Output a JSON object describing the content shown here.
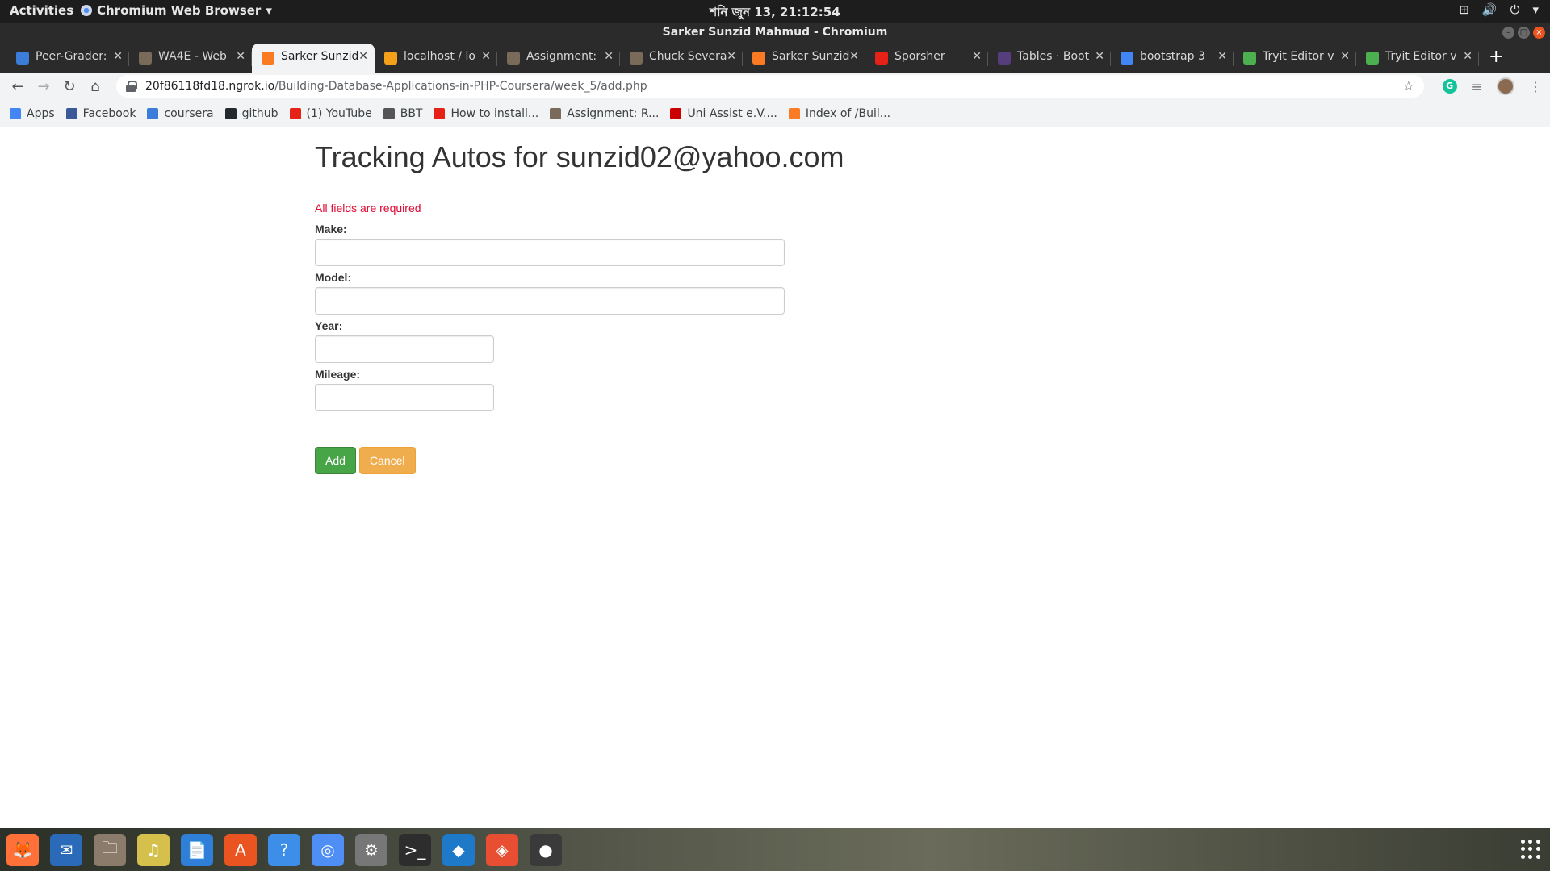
{
  "topbar": {
    "activities": "Activities",
    "app_menu": "Chromium Web Browser",
    "clock": "শনি জুন 13, 21:12:54"
  },
  "window": {
    "title": "Sarker Sunzid Mahmud - Chromium"
  },
  "tabs": [
    {
      "label": "Peer-Grader:",
      "icon": "coursera-icon",
      "color": "#3b7dd8",
      "active": false
    },
    {
      "label": "WA4E - Web",
      "icon": "wa4e-icon",
      "color": "#7a6a5a",
      "active": false
    },
    {
      "label": "Sarker Sunzid",
      "icon": "xampp-icon",
      "color": "#fb7a24",
      "active": true
    },
    {
      "label": "localhost / lo",
      "icon": "phpmyadmin-icon",
      "color": "#f4a019",
      "active": false
    },
    {
      "label": "Assignment:",
      "icon": "wa4e-icon",
      "color": "#7a6a5a",
      "active": false
    },
    {
      "label": "Chuck Severa",
      "icon": "wa4e-icon",
      "color": "#7a6a5a",
      "active": false
    },
    {
      "label": "Sarker Sunzid",
      "icon": "xampp-icon",
      "color": "#fb7a24",
      "active": false
    },
    {
      "label": "Sporsher",
      "icon": "youtube-icon",
      "color": "#e62117",
      "active": false
    },
    {
      "label": "Tables · Boot",
      "icon": "bootstrap-icon",
      "color": "#563d7c",
      "active": false
    },
    {
      "label": "bootstrap 3",
      "icon": "google-icon",
      "color": "#4285f4",
      "active": false
    },
    {
      "label": "Tryit Editor v",
      "icon": "w3schools-icon",
      "color": "#4caf50",
      "active": false
    },
    {
      "label": "Tryit Editor v",
      "icon": "w3schools-icon",
      "color": "#4caf50",
      "active": false
    }
  ],
  "omnibox": {
    "host": "20f86118fd18.ngrok.io",
    "path": "/Building-Database-Applications-in-PHP-Coursera/week_5/add.php"
  },
  "bookmarks": [
    {
      "label": "Apps",
      "icon": "apps-icon",
      "color": "#4285f4"
    },
    {
      "label": "Facebook",
      "icon": "facebook-icon",
      "color": "#3b5998"
    },
    {
      "label": "coursera",
      "icon": "coursera-icon",
      "color": "#3b7dd8"
    },
    {
      "label": "github",
      "icon": "github-icon",
      "color": "#24292e"
    },
    {
      "label": "(1) YouTube",
      "icon": "youtube-icon",
      "color": "#e62117"
    },
    {
      "label": "BBT",
      "icon": "globe-icon",
      "color": "#555555"
    },
    {
      "label": "How to install...",
      "icon": "youtube-icon",
      "color": "#e62117"
    },
    {
      "label": "Assignment: R...",
      "icon": "wa4e-icon",
      "color": "#7a6a5a"
    },
    {
      "label": "Uni Assist e.V....",
      "icon": "uniassist-icon",
      "color": "#cc0000"
    },
    {
      "label": "Index of /Buil...",
      "icon": "xampp-icon",
      "color": "#fb7a24"
    }
  ],
  "page": {
    "heading": "Tracking Autos for sunzid02@yahoo.com",
    "error": "All fields are required",
    "fields": {
      "make_label": "Make:",
      "model_label": "Model:",
      "year_label": "Year:",
      "mileage_label": "Mileage:"
    },
    "add_button": "Add",
    "cancel_button": "Cancel",
    "colors": {
      "error": "#e00a34",
      "add": "#47a447",
      "cancel": "#f0ad4e"
    }
  },
  "dock": [
    {
      "name": "firefox-icon",
      "color": "#ff7139",
      "glyph": "🦊"
    },
    {
      "name": "thunderbird-icon",
      "color": "#2a6ab8",
      "glyph": "✉"
    },
    {
      "name": "files-icon",
      "color": "#8b7b6b",
      "glyph": "🗀"
    },
    {
      "name": "rhythmbox-icon",
      "color": "#d4c04a",
      "glyph": "♫"
    },
    {
      "name": "libreoffice-writer-icon",
      "color": "#2f7ed8",
      "glyph": "📄"
    },
    {
      "name": "software-center-icon",
      "color": "#e95420",
      "glyph": "A"
    },
    {
      "name": "help-icon",
      "color": "#3d8ee8",
      "glyph": "?"
    },
    {
      "name": "chromium-icon",
      "color": "#4f8ff5",
      "glyph": "◎"
    },
    {
      "name": "settings-icon",
      "color": "#777777",
      "glyph": "⚙"
    },
    {
      "name": "terminal-icon",
      "color": "#2d2d2d",
      "glyph": ">_"
    },
    {
      "name": "vscode-icon",
      "color": "#1e7ac8",
      "glyph": "◆"
    },
    {
      "name": "git-icon",
      "color": "#e84e32",
      "glyph": "◈"
    },
    {
      "name": "screen-recorder-icon",
      "color": "#3a3a3a",
      "glyph": "●"
    }
  ]
}
